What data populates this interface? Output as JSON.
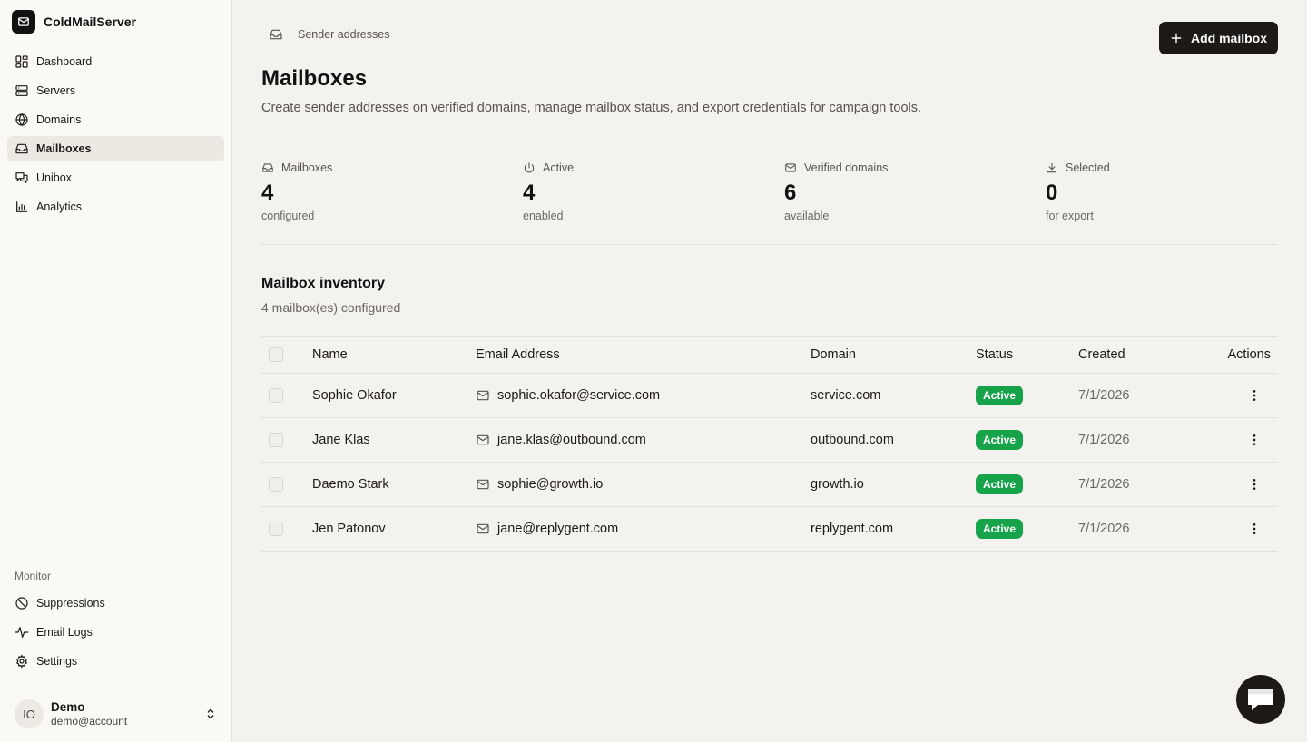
{
  "app": {
    "name": "ColdMailServer"
  },
  "sidebar": {
    "items": [
      {
        "label": "Dashboard",
        "icon": "dashboard-icon"
      },
      {
        "label": "Servers",
        "icon": "server-icon"
      },
      {
        "label": "Domains",
        "icon": "globe-icon"
      },
      {
        "label": "Mailboxes",
        "icon": "inbox-icon",
        "active": true
      },
      {
        "label": "Unibox",
        "icon": "chat-icon"
      },
      {
        "label": "Analytics",
        "icon": "chart-icon"
      }
    ],
    "monitor_label": "Monitor",
    "monitor_items": [
      {
        "label": "Suppressions",
        "icon": "ban-icon"
      },
      {
        "label": "Email Logs",
        "icon": "activity-icon"
      },
      {
        "label": "Settings",
        "icon": "gear-icon"
      }
    ],
    "user": {
      "initials": "IO",
      "name": "Demo",
      "email": "demo@account"
    }
  },
  "header": {
    "breadcrumb": "Sender addresses",
    "add_button": "Add mailbox",
    "title": "Mailboxes",
    "subtitle": "Create sender addresses on verified domains, manage mailbox status, and export credentials for campaign tools."
  },
  "stats": [
    {
      "label": "Mailboxes",
      "value": "4",
      "sub": "configured",
      "icon": "inbox-icon"
    },
    {
      "label": "Active",
      "value": "4",
      "sub": "enabled",
      "icon": "power-icon"
    },
    {
      "label": "Verified domains",
      "value": "6",
      "sub": "available",
      "icon": "mail-icon"
    },
    {
      "label": "Selected",
      "value": "0",
      "sub": "for export",
      "icon": "download-icon"
    }
  ],
  "inventory": {
    "title": "Mailbox inventory",
    "subtitle": "4 mailbox(es) configured",
    "columns": [
      "Name",
      "Email Address",
      "Domain",
      "Status",
      "Created",
      "Actions"
    ],
    "rows": [
      {
        "name": "Sophie Okafor",
        "email": "sophie.okafor@service.com",
        "domain": "service.com",
        "status": "Active",
        "created": "7/1/2026"
      },
      {
        "name": "Jane Klas",
        "email": "jane.klas@outbound.com",
        "domain": "outbound.com",
        "status": "Active",
        "created": "7/1/2026"
      },
      {
        "name": "Daemo Stark",
        "email": "sophie@growth.io",
        "domain": "growth.io",
        "status": "Active",
        "created": "7/1/2026"
      },
      {
        "name": "Jen Patonov",
        "email": "jane@replygent.com",
        "domain": "replygent.com",
        "status": "Active",
        "created": "7/1/2026"
      }
    ]
  },
  "colors": {
    "primary": "#1c1917",
    "success": "#16a34a",
    "background": "#f4f2ee",
    "sidebar": "#faf9f6"
  }
}
